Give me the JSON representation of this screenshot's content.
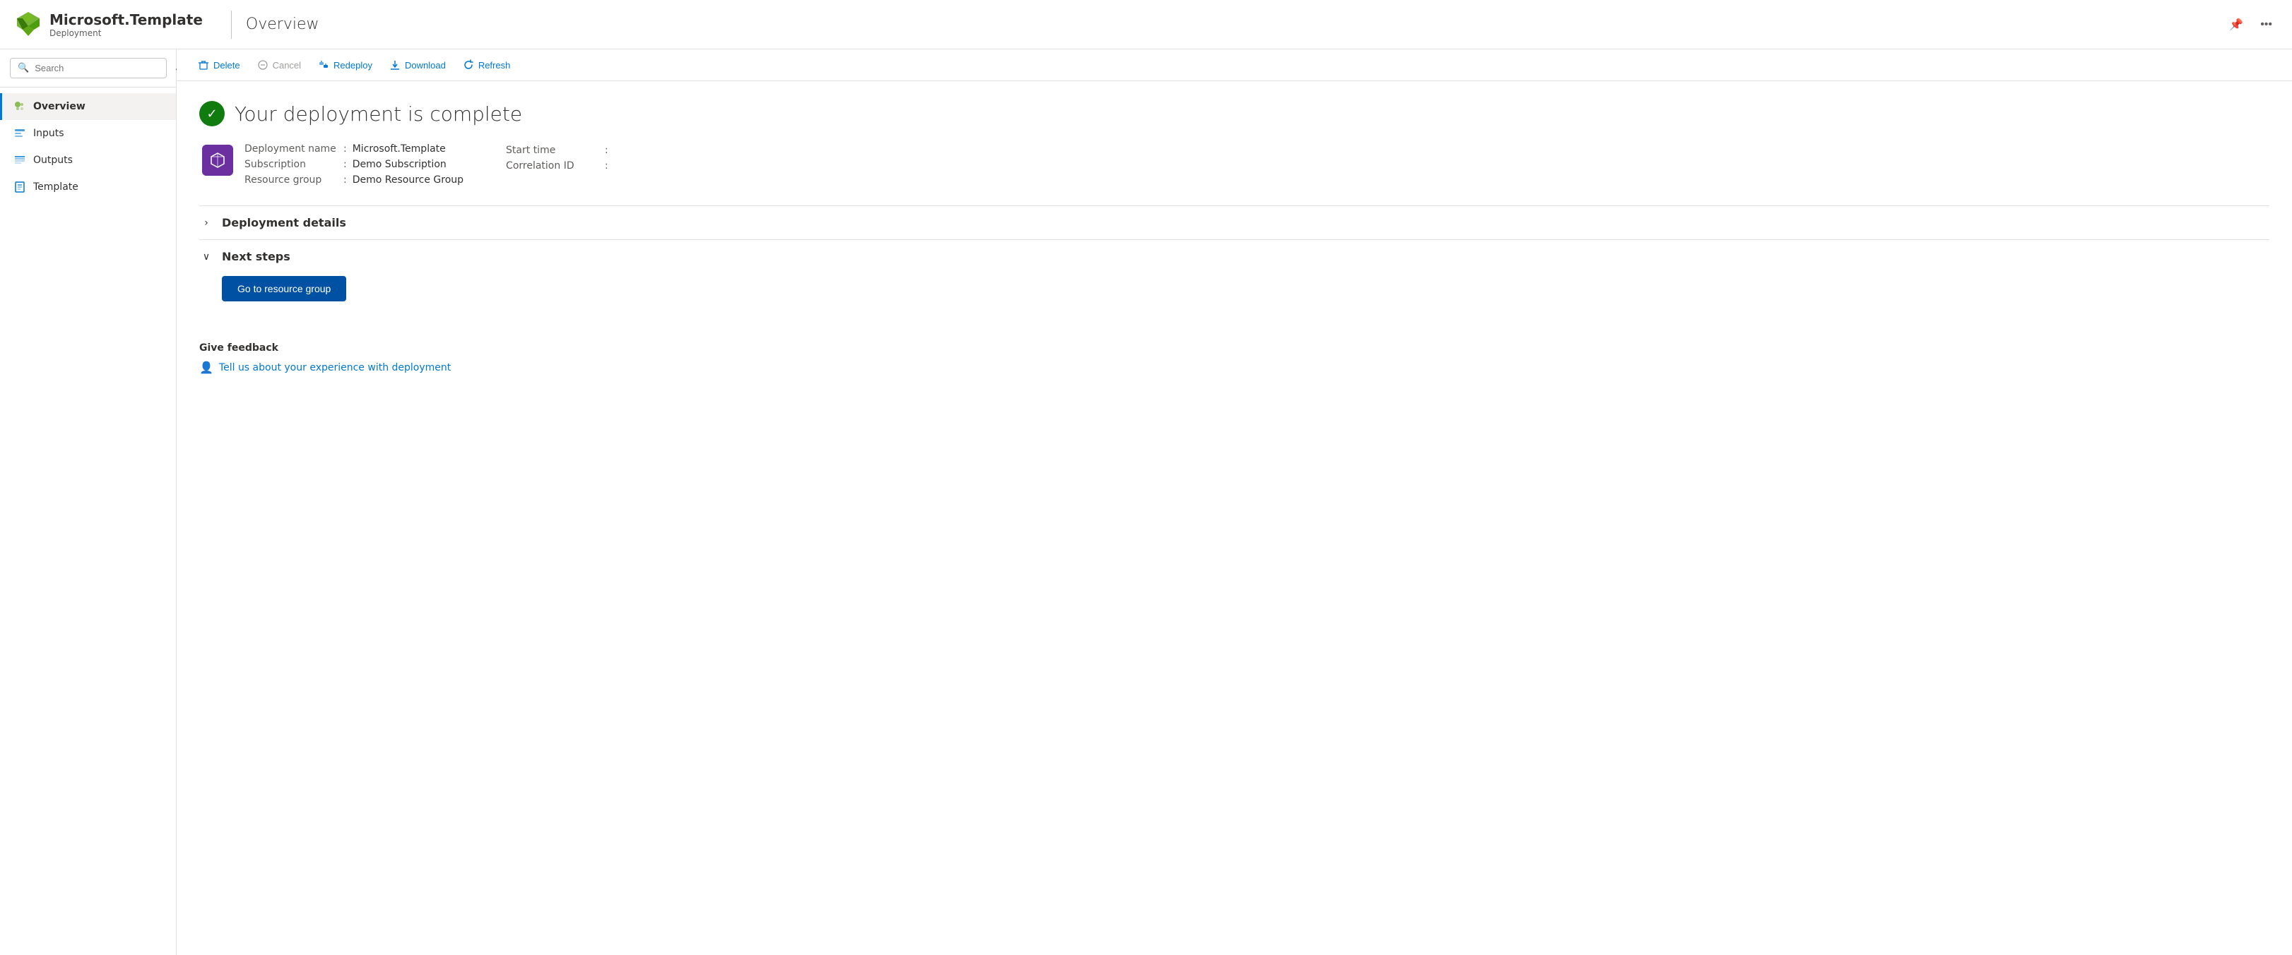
{
  "header": {
    "app_name": "Microsoft.Template",
    "subtitle": "Deployment",
    "page_title": "Overview",
    "pin_icon": "📌",
    "more_icon": "···"
  },
  "sidebar": {
    "search_placeholder": "Search",
    "collapse_label": "«",
    "items": [
      {
        "id": "overview",
        "label": "Overview",
        "active": true,
        "icon": "overview"
      },
      {
        "id": "inputs",
        "label": "Inputs",
        "active": false,
        "icon": "inputs"
      },
      {
        "id": "outputs",
        "label": "Outputs",
        "active": false,
        "icon": "outputs"
      },
      {
        "id": "template",
        "label": "Template",
        "active": false,
        "icon": "template"
      }
    ]
  },
  "toolbar": {
    "delete_label": "Delete",
    "cancel_label": "Cancel",
    "redeploy_label": "Redeploy",
    "download_label": "Download",
    "refresh_label": "Refresh"
  },
  "content": {
    "status_title": "Your deployment is complete",
    "deployment_name_label": "Deployment name",
    "deployment_name_value": "Microsoft.Template",
    "subscription_label": "Subscription",
    "subscription_value": "Demo Subscription",
    "resource_group_label": "Resource group",
    "resource_group_value": "Demo Resource Group",
    "start_time_label": "Start time",
    "start_time_value": "",
    "correlation_id_label": "Correlation ID",
    "correlation_id_value": "",
    "deployment_details_label": "Deployment details",
    "next_steps_label": "Next steps",
    "go_to_resource_group_label": "Go to resource group",
    "feedback_title": "Give feedback",
    "feedback_link": "Tell us about your experience with deployment"
  }
}
